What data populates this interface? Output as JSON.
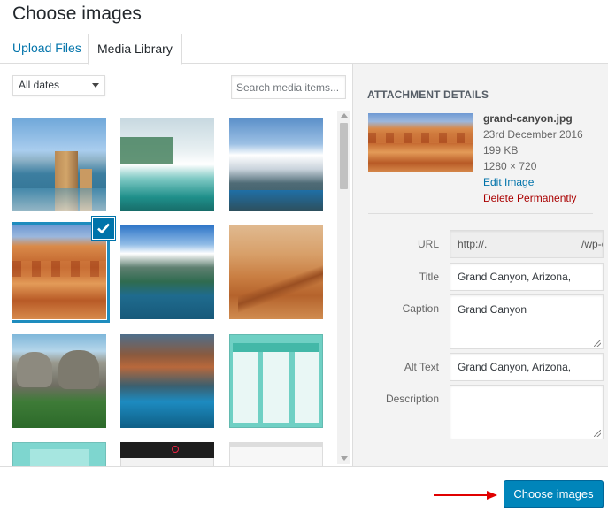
{
  "modal": {
    "title": "Choose images"
  },
  "tabs": [
    {
      "label": "Upload Files",
      "active": false
    },
    {
      "label": "Media Library",
      "active": true
    }
  ],
  "toolbar": {
    "date_filter": "All dates",
    "search_placeholder": "Search media items..."
  },
  "attachment": {
    "heading": "ATTACHMENT DETAILS",
    "filename": "grand-canyon.jpg",
    "date": "23rd December 2016",
    "size": "199 KB",
    "dimensions": "1280 × 720",
    "edit_link": "Edit Image",
    "delete_link": "Delete Permanently"
  },
  "fields": {
    "url_label": "URL",
    "url_value": "http://.                                /wp-co",
    "title_label": "Title",
    "title_value": "Grand Canyon, Arizona, USA",
    "caption_label": "Caption",
    "caption_value": "Grand Canyon",
    "alt_label": "Alt Text",
    "alt_value": "Grand Canyon, Arizona, USA",
    "description_label": "Description",
    "description_value": ""
  },
  "footer": {
    "choose_button": "Choose images"
  },
  "colors": {
    "accent": "#0085ba",
    "link": "#0073aa",
    "danger": "#a00000",
    "arrow": "#e00000"
  }
}
